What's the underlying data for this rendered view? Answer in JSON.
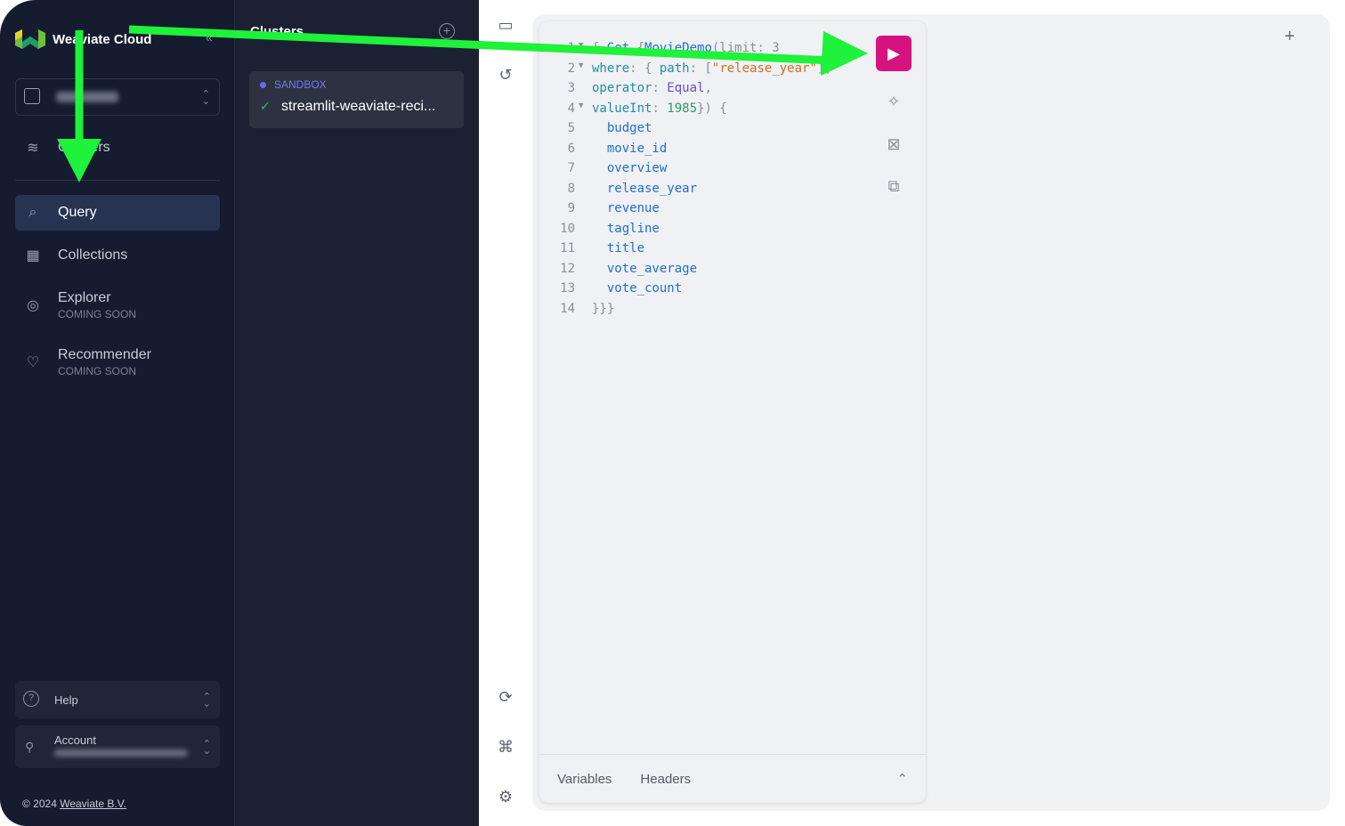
{
  "sidebar": {
    "brand": "Weaviate Cloud",
    "nav": [
      {
        "label": "Clusters"
      },
      {
        "label": "Query"
      },
      {
        "label": "Collections"
      },
      {
        "label": "Explorer",
        "sub": "COMING SOON"
      },
      {
        "label": "Recommender",
        "sub": "COMING SOON"
      }
    ],
    "help": "Help",
    "account": "Account",
    "copyright": "© 2024",
    "company_link": "Weaviate B.V."
  },
  "clusters": {
    "title": "Clusters",
    "items": [
      {
        "tier": "SANDBOX",
        "name": "streamlit-weaviate-reci..."
      }
    ]
  },
  "editor": {
    "lines": [
      [
        [
          "p",
          "{ "
        ],
        [
          "f",
          "Get "
        ],
        [
          "p",
          "{"
        ],
        [
          "f",
          "MovieDemo"
        ],
        [
          "p",
          "(limit: 3"
        ]
      ],
      [
        [
          "k",
          "where"
        ],
        [
          "p",
          ": { "
        ],
        [
          "k",
          "path"
        ],
        [
          "p",
          ": ["
        ],
        [
          "s",
          "\"release_year\""
        ],
        [
          "p",
          "],"
        ]
      ],
      [
        [
          "k",
          "operator"
        ],
        [
          "p",
          ": "
        ],
        [
          "e",
          "Equal"
        ],
        [
          "p",
          ","
        ]
      ],
      [
        [
          "k",
          "valueInt"
        ],
        [
          "p",
          ": "
        ],
        [
          "n",
          "1985"
        ],
        [
          "p",
          "}) {"
        ]
      ],
      [
        [
          "f",
          "  budget"
        ]
      ],
      [
        [
          "f",
          "  movie_id"
        ]
      ],
      [
        [
          "f",
          "  overview"
        ]
      ],
      [
        [
          "f",
          "  release_year"
        ]
      ],
      [
        [
          "f",
          "  revenue"
        ]
      ],
      [
        [
          "f",
          "  tagline"
        ]
      ],
      [
        [
          "f",
          "  title"
        ]
      ],
      [
        [
          "f",
          "  vote_average"
        ]
      ],
      [
        [
          "f",
          "  vote_count"
        ]
      ],
      [
        [
          "p",
          "}}}"
        ]
      ]
    ],
    "tabs": [
      "Variables",
      "Headers"
    ]
  },
  "colors": {
    "run": "#d6127f",
    "annotation": "#1ef23a"
  }
}
